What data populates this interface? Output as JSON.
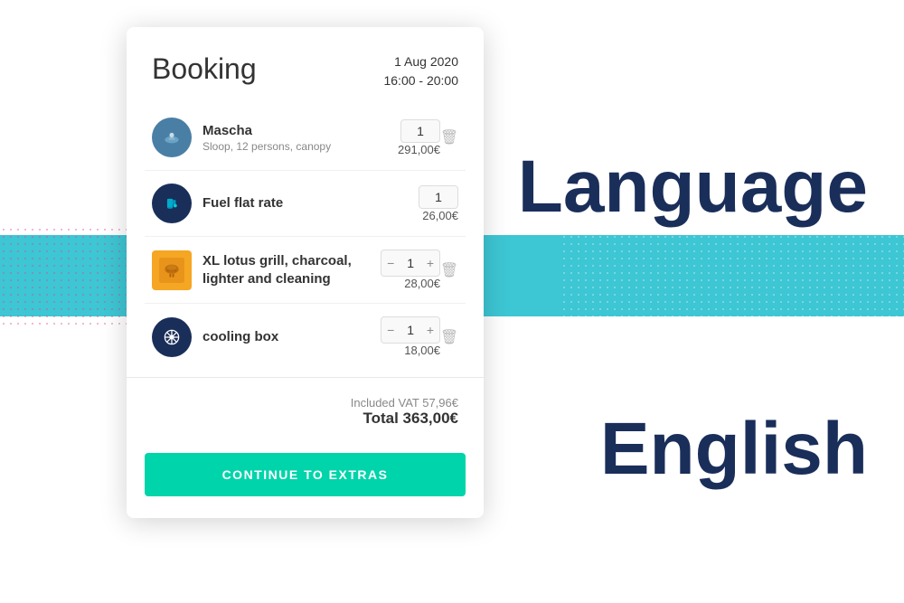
{
  "background": {
    "stripe_color": "#1bbccc"
  },
  "language_label": "Language",
  "english_label": "English",
  "card": {
    "title": "Booking",
    "date": "1 Aug 2020",
    "time": "16:00 - 20:00",
    "items": [
      {
        "name": "Mascha",
        "desc": "Sloop, 12 persons, canopy",
        "qty": "1",
        "price": "291,00€",
        "has_controls": false,
        "icon_type": "boat"
      },
      {
        "name": "Fuel flat rate",
        "desc": "",
        "qty": "1",
        "price": "26,00€",
        "has_controls": false,
        "icon_type": "fuel"
      },
      {
        "name": "XL lotus grill, charcoal, lighter and cleaning",
        "desc": "",
        "qty": "1",
        "price": "28,00€",
        "has_controls": true,
        "icon_type": "grill"
      },
      {
        "name": "cooling box",
        "desc": "",
        "qty": "1",
        "price": "18,00€",
        "has_controls": true,
        "icon_type": "cooling"
      }
    ],
    "vat_text": "Included VAT 57,96€",
    "total_text": "Total 363,00€",
    "continue_label": "CONTINUE TO EXTRAS"
  }
}
